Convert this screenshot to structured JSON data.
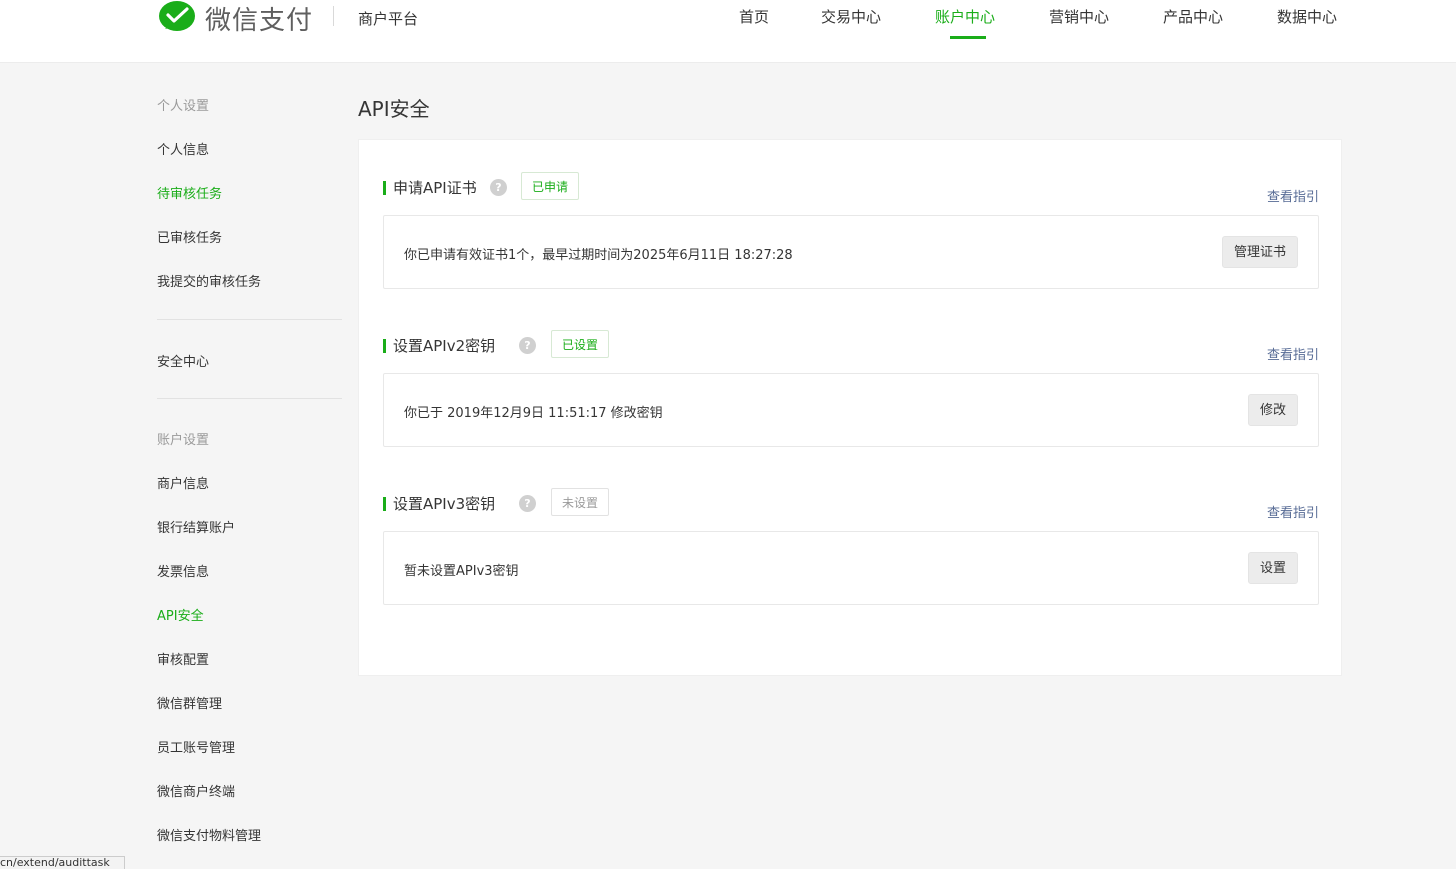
{
  "header": {
    "brand": "微信支付",
    "platform": "商户平台",
    "nav": [
      {
        "label": "首页",
        "active": false
      },
      {
        "label": "交易中心",
        "active": false
      },
      {
        "label": "账户中心",
        "active": true
      },
      {
        "label": "营销中心",
        "active": false
      },
      {
        "label": "产品中心",
        "active": false
      },
      {
        "label": "数据中心",
        "active": false
      }
    ]
  },
  "sidebar": {
    "group1": "个人设置",
    "items1": [
      "个人信息",
      "待审核任务",
      "已审核任务",
      "我提交的审核任务"
    ],
    "security": "安全中心",
    "group2": "账户设置",
    "items2": [
      "商户信息",
      "银行结算账户",
      "发票信息",
      "API安全",
      "审核配置",
      "微信群管理",
      "员工账号管理",
      "微信商户终端",
      "微信支付物料管理"
    ],
    "active_items": [
      "待审核任务",
      "API安全"
    ]
  },
  "main": {
    "title": "API安全",
    "help_symbol": "?",
    "sections": [
      {
        "title": "申请API证书",
        "badge": "已申请",
        "badge_state": "done",
        "guide": "查看指引",
        "text": "你已申请有效证书1个，最早过期时间为2025年6月11日 18:27:28",
        "button": "管理证书"
      },
      {
        "title": "设置APIv2密钥",
        "badge": "已设置",
        "badge_state": "done",
        "guide": "查看指引",
        "text": "你已于 2019年12月9日 11:51:17 修改密钥",
        "button": "修改"
      },
      {
        "title": "设置APIv3密钥",
        "badge": "未设置",
        "badge_state": "none",
        "guide": "查看指引",
        "text": "暂未设置APIv3密钥",
        "button": "设置"
      }
    ]
  },
  "status_bar": {
    "url": "cn/extend/audittask"
  },
  "colors": {
    "accent": "#1aad19",
    "link": "#576b95",
    "muted": "#9a9a9a"
  }
}
